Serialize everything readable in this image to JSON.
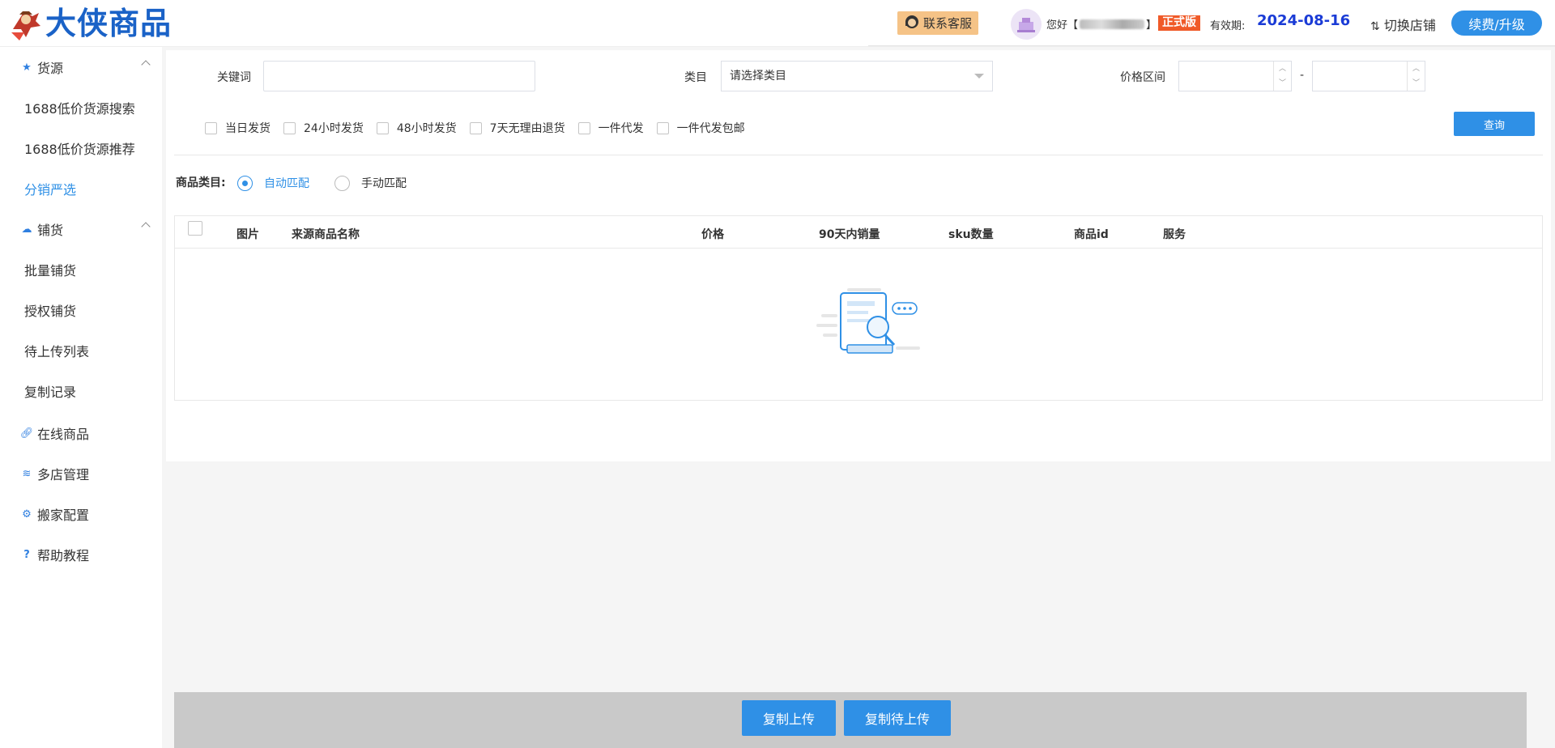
{
  "header": {
    "logo_text": "大侠商品",
    "support_label": "联系客服",
    "greeting_prefix": "您好【",
    "greeting_suffix": "】",
    "edition_badge": "正式版",
    "valid_label": "有效期:",
    "valid_date": "2024-08-16",
    "switch_shop_label": "切换店铺",
    "upgrade_label": "续费/升级"
  },
  "sidebar": {
    "groups": [
      {
        "label": "货源",
        "icon": "star-icon"
      },
      {
        "label": "铺货",
        "icon": "cloud-upload-icon"
      }
    ],
    "sub_items": [
      "1688低价货源搜索",
      "1688低价货源推荐",
      "分销严选",
      "批量铺货",
      "授权铺货",
      "待上传列表",
      "复制记录"
    ],
    "items": [
      {
        "label": "在线商品",
        "icon": "link-icon"
      },
      {
        "label": "多店管理",
        "icon": "layers-icon"
      },
      {
        "label": "搬家配置",
        "icon": "gear-icon"
      },
      {
        "label": "帮助教程",
        "icon": "question-icon"
      }
    ],
    "active_item": "分销严选"
  },
  "filters": {
    "keyword_label": "关键词",
    "keyword_value": "",
    "category_label": "类目",
    "category_placeholder": "请选择类目",
    "price_label": "价格区间",
    "price_separator": "-",
    "checkboxes": [
      "当日发货",
      "24小时发货",
      "48小时发货",
      "7天无理由退货",
      "一件代发",
      "一件代发包邮"
    ],
    "query_label": "查询"
  },
  "match": {
    "label": "商品类目:",
    "options": [
      "自动匹配",
      "手动匹配"
    ],
    "selected": "自动匹配"
  },
  "table": {
    "columns": [
      "图片",
      "来源商品名称",
      "价格",
      "90天内销量",
      "sku数量",
      "商品id",
      "服务"
    ],
    "rows": []
  },
  "footer": {
    "copy_upload": "复制上传",
    "copy_pending": "复制待上传"
  },
  "colors": {
    "primary": "#2f90e6",
    "logo": "#1a62c7",
    "badge": "#f05a28",
    "date": "#1a3bd6",
    "support_bg": "#f5c387"
  }
}
